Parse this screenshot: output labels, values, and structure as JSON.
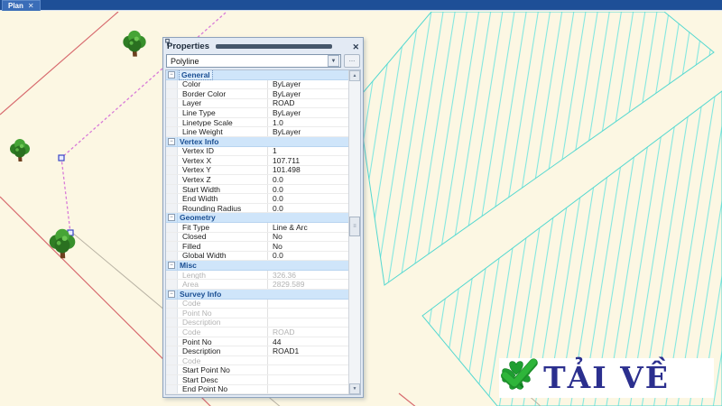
{
  "window": {
    "tab_label": "Plan",
    "close_glyph": "✕"
  },
  "panel": {
    "title": "Properties",
    "close_glyph": "✕",
    "collapse_glyph": "−",
    "selector": {
      "value": "Polyline",
      "dropdown_glyph": "▼",
      "more_label": "..."
    },
    "scrollbar": {
      "up_glyph": "▲",
      "down_glyph": "▼",
      "thumb_glyph": "≡"
    },
    "sections": [
      {
        "label": "General",
        "focused": true,
        "rows": [
          {
            "name": "Color",
            "value": "ByLayer"
          },
          {
            "name": "Border Color",
            "value": "ByLayer"
          },
          {
            "name": "Layer",
            "value": "ROAD"
          },
          {
            "name": "Line Type",
            "value": "ByLayer"
          },
          {
            "name": "Linetype Scale",
            "value": "1.0"
          },
          {
            "name": "Line Weight",
            "value": "ByLayer"
          }
        ]
      },
      {
        "label": "Vertex Info",
        "focused": false,
        "rows": [
          {
            "name": "Vertex ID",
            "value": "1"
          },
          {
            "name": "Vertex X",
            "value": "107.711"
          },
          {
            "name": "Vertex Y",
            "value": "101.498"
          },
          {
            "name": "Vertex Z",
            "value": "0.0"
          },
          {
            "name": "Start Width",
            "value": "0.0"
          },
          {
            "name": "End Width",
            "value": "0.0"
          },
          {
            "name": "Rounding Radius",
            "value": "0.0"
          }
        ]
      },
      {
        "label": "Geometry",
        "focused": false,
        "rows": [
          {
            "name": "Fit Type",
            "value": "Line & Arc"
          },
          {
            "name": "Closed",
            "value": "No"
          },
          {
            "name": "Filled",
            "value": "No"
          },
          {
            "name": "Global Width",
            "value": "0.0"
          }
        ]
      },
      {
        "label": "Misc",
        "focused": false,
        "rows": [
          {
            "name": "Length",
            "value": "326.36",
            "muted": true
          },
          {
            "name": "Area",
            "value": "2829.589",
            "muted": true
          }
        ]
      },
      {
        "label": "Survey Info",
        "focused": false,
        "rows": [
          {
            "name": "Code",
            "value": "",
            "muted": true
          },
          {
            "name": "Point No",
            "value": "",
            "muted": true
          },
          {
            "name": "Description",
            "value": "",
            "muted": true
          },
          {
            "name": "Code",
            "value": "ROAD",
            "muted": true
          },
          {
            "name": "Point No",
            "value": "44"
          },
          {
            "name": "Description",
            "value": "ROAD1"
          },
          {
            "name": "Code",
            "value": "",
            "muted": true
          },
          {
            "name": "Start Point No",
            "value": ""
          },
          {
            "name": "Start Desc",
            "value": ""
          },
          {
            "name": "End Point No",
            "value": ""
          }
        ]
      }
    ]
  },
  "banner": {
    "text": "TẢI VỀ"
  },
  "colors": {
    "titlebar_blue": "#1e4f97",
    "tab_blue": "#3a6db8",
    "canvas_cream": "#fcf7e3",
    "hatch_cyan": "#82e7e0",
    "boundary_cyan": "#55d8d0",
    "survey_red": "#d76a6e",
    "survey_gray": "#b9b3a4",
    "selected_polyline_magenta": "#d87ad8",
    "grip_blue": "#3a46c4",
    "section_header_bg": "#cfe5fa",
    "section_header_text": "#1a4f93",
    "banner_text_blue": "#2b2f8e",
    "clover_green": "#1e9e31",
    "check_green": "#2eb53a"
  }
}
